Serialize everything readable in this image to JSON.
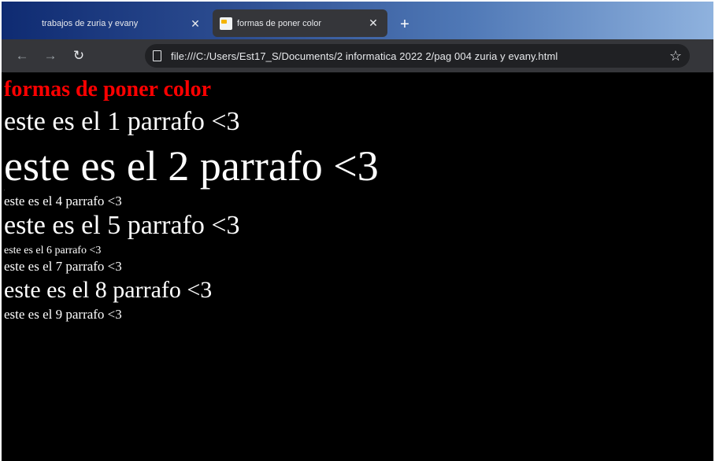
{
  "browser": {
    "tabs": [
      {
        "title": "trabajos de zuria y evany",
        "active": false
      },
      {
        "title": "formas de poner color",
        "active": true
      }
    ],
    "new_tab_glyph": "+",
    "close_glyph": "✕",
    "address_bar": {
      "url": "file:///C:/Users/Est17_S/Documents/2 informatica 2022 2/pag 004 zuria y evany.html"
    },
    "icons": {
      "back": "arrow-left-icon",
      "forward": "arrow-right-icon",
      "reload": "reload-icon",
      "page": "file-icon",
      "bookmark": "star-icon"
    }
  },
  "page": {
    "heading": "formas de poner color",
    "heading_color": "#ff0000",
    "background_color": "#000000",
    "text_color": "#ffffff",
    "paragraphs": [
      "este es el 1 parrafo <3",
      "este es el 2 parrafo <3",
      "-",
      "este es el 4 parrafo <3",
      "este es el 5 parrafo <3",
      "este es el 6 parrafo <3",
      "este es el 7 parrafo <3",
      "este es el 8 parrafo <3",
      "este es el 9 parrafo <3"
    ]
  }
}
